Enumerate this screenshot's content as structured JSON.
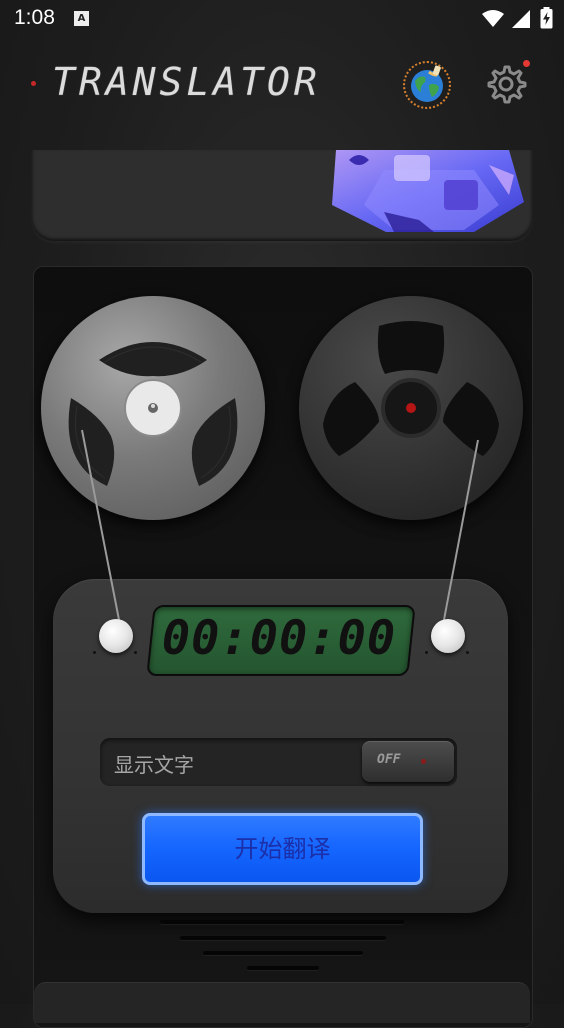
{
  "status_bar": {
    "time": "1:08",
    "notification_icon": "A",
    "icons": [
      "wifi-icon",
      "signal-icon",
      "battery-charging-icon"
    ]
  },
  "header": {
    "title": "TRANSLATOR",
    "language_icon": "globe-icon",
    "settings_icon": "gear-icon",
    "settings_badge": true
  },
  "recorder": {
    "timer": "00:00:00",
    "show_text_label": "显示文字",
    "toggle_label": "OFF",
    "toggle_state": false,
    "start_button_label": "开始翻译"
  },
  "colors": {
    "accent_blue": "#1565ff",
    "lcd_green": "#2f6a3c",
    "led_red": "#c62828",
    "badge_red": "#e53935"
  }
}
